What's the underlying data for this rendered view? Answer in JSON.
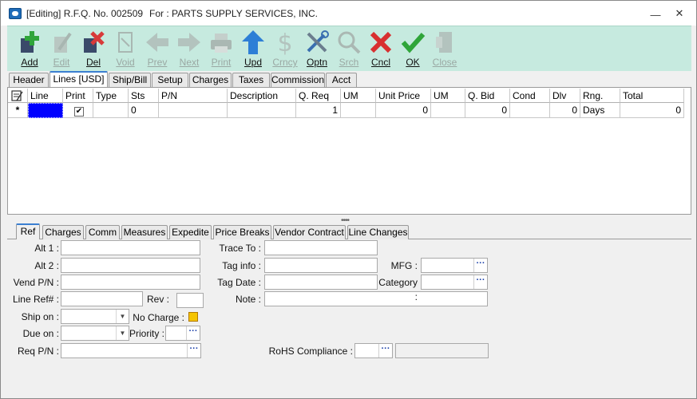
{
  "window": {
    "title": "[Editing] R.F.Q. No. 002509",
    "for_text": "For : PARTS SUPPLY SERVICES, INC.",
    "minimize": "—",
    "close": "✕"
  },
  "toolbar": {
    "add": "Add",
    "edit": "Edit",
    "del": "Del",
    "void": "Void",
    "prev": "Prev",
    "next": "Next",
    "print": "Print",
    "upd": "Upd",
    "crncy": "Crncy",
    "optn": "Optn",
    "srch": "Srch",
    "cncl": "Cncl",
    "ok": "OK",
    "close": "Close"
  },
  "tabs": {
    "header": "Header",
    "lines": "Lines [USD]",
    "ship_bill": "Ship/Bill",
    "setup": "Setup",
    "charges": "Charges",
    "taxes": "Taxes",
    "commission": "Commission",
    "acct": "Acct"
  },
  "grid": {
    "columns": {
      "line": "Line",
      "print": "Print",
      "type": "Type",
      "sts": "Sts",
      "pn": "P/N",
      "description": "Description",
      "q_req": "Q. Req",
      "um": "UM",
      "unit_price": "Unit Price",
      "um2": "UM",
      "q_bid": "Q. Bid",
      "cond": "Cond",
      "dlv": "Dlv",
      "rng": "Rng.",
      "total": "Total"
    },
    "row": {
      "marker": "*",
      "sts": "0",
      "q_req": "1",
      "unit_price": "0",
      "q_bid": "0",
      "dlv": "0",
      "rng": "Days",
      "total": "0"
    }
  },
  "subtabs": {
    "ref": "Ref",
    "charges": "Charges",
    "comm": "Comm",
    "measures": "Measures",
    "expedite": "Expedite",
    "price_breaks": "Price Breaks",
    "vendor_contract": "Vendor Contract",
    "line_changes": "Line Changes"
  },
  "form": {
    "alt1": "Alt 1 :",
    "alt2": "Alt 2 :",
    "vend_pn": "Vend P/N :",
    "line_ref": "Line Ref# :",
    "rev": "Rev :",
    "ship_on": "Ship on :",
    "no_charge": "No Charge :",
    "due_on": "Due on :",
    "priority": "Priority :",
    "req_pn": "Req P/N :",
    "trace_to": "Trace To :",
    "tag_info": "Tag info :",
    "mfg": "MFG :",
    "tag_date": "Tag Date :",
    "category": "Category :",
    "note": "Note :",
    "rohs": "RoHS Compliance :"
  }
}
